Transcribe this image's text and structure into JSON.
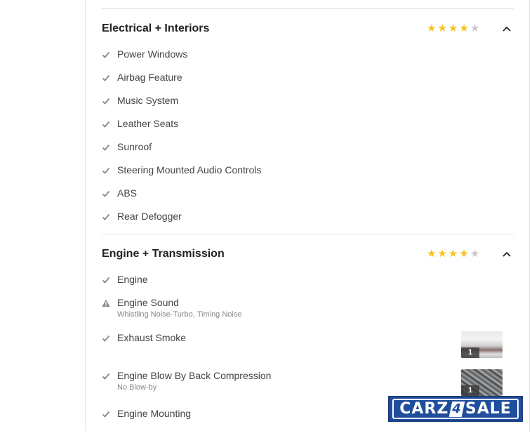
{
  "sections": [
    {
      "title": "Electrical + Interiors",
      "rating": 4,
      "max_rating": 5,
      "items": [
        {
          "label": "Power Windows",
          "status": "ok"
        },
        {
          "label": "Airbag Feature",
          "status": "ok"
        },
        {
          "label": "Music System",
          "status": "ok"
        },
        {
          "label": "Leather Seats",
          "status": "ok"
        },
        {
          "label": "Sunroof",
          "status": "ok"
        },
        {
          "label": "Steering Mounted Audio Controls",
          "status": "ok"
        },
        {
          "label": "ABS",
          "status": "ok"
        },
        {
          "label": "Rear Defogger",
          "status": "ok"
        }
      ]
    },
    {
      "title": "Engine + Transmission",
      "rating": 4,
      "max_rating": 5,
      "items": [
        {
          "label": "Engine",
          "status": "ok"
        },
        {
          "label": "Engine Sound",
          "status": "warning",
          "note": "Whistling Noise-Turbo, Timing Noise"
        },
        {
          "label": "Exhaust Smoke",
          "status": "ok",
          "photo_count": "1"
        },
        {
          "label": "Engine Blow By Back Compression",
          "status": "ok",
          "note": "No Blow-by",
          "photo_count": "1"
        },
        {
          "label": "Engine Mounting",
          "status": "ok"
        }
      ]
    }
  ],
  "icons": {
    "ok": "check-icon",
    "warning": "warning-icon",
    "collapse": "chevron-up-icon",
    "star": "star-icon"
  },
  "colors": {
    "star_on": "#f6c21c",
    "star_off": "#c8c8c8",
    "brand": "#1f4e9c"
  },
  "brand": {
    "part1": "CARZ",
    "part2": "4",
    "part3": "SALE"
  }
}
